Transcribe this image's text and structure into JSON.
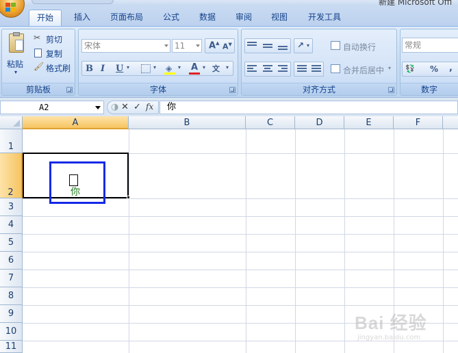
{
  "window": {
    "title": "新建 Microsoft Offi"
  },
  "tabs": [
    {
      "label": "开始",
      "active": true
    },
    {
      "label": "插入"
    },
    {
      "label": "页面布局"
    },
    {
      "label": "公式"
    },
    {
      "label": "数据"
    },
    {
      "label": "审阅"
    },
    {
      "label": "视图"
    },
    {
      "label": "开发工具"
    }
  ],
  "ribbon": {
    "clipboard": {
      "label": "剪贴板",
      "paste": "粘贴",
      "cut": "剪切",
      "copy": "复制",
      "format_painter": "格式刷"
    },
    "font": {
      "label": "字体",
      "font_name": "宋体",
      "font_size": "11"
    },
    "alignment": {
      "label": "对齐方式",
      "wrap_text": "自动换行",
      "merge_center": "合并后居中"
    },
    "number": {
      "label": "数字",
      "format": "常规",
      "percent": "%",
      "comma": ","
    }
  },
  "formula_bar": {
    "name_box": "A2",
    "content": "你"
  },
  "sheet": {
    "columns": [
      "A",
      "B",
      "C",
      "D",
      "E",
      "F"
    ],
    "rows": [
      "1",
      "2",
      "3",
      "4",
      "5",
      "6",
      "7",
      "8",
      "9",
      "10",
      "11"
    ],
    "selected_column": "A",
    "selected_row": "2",
    "cell_A2_text": "你"
  },
  "watermark": {
    "text": "Bai 经验",
    "sub": "jingyan.baidu.com"
  },
  "colors": {
    "accent": "#1428e6",
    "selection": "#f7c462",
    "ribbon": "#c6daf3"
  }
}
